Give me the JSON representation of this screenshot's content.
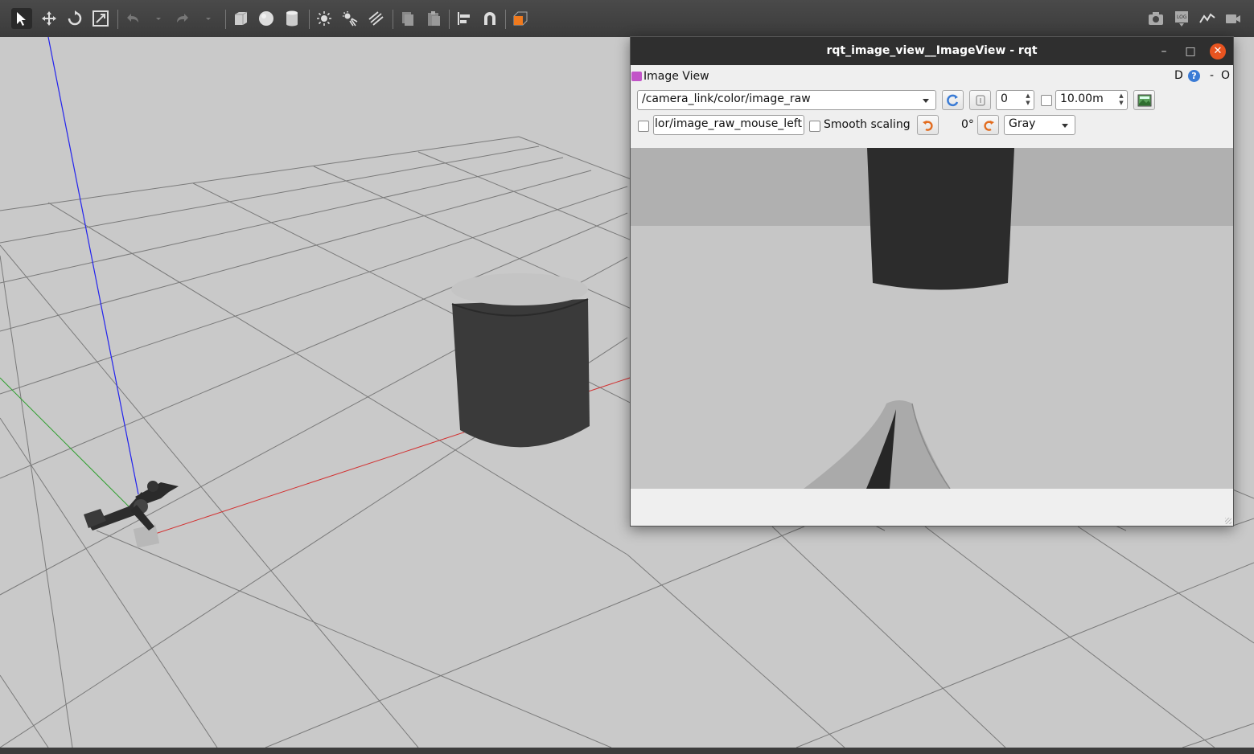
{
  "toolbar": {
    "left_tools": [
      "select-mode-icon",
      "translate-mode-icon",
      "rotate-mode-icon",
      "scale-mode-icon",
      "undo-icon",
      "undo-history-icon",
      "redo-icon",
      "redo-history-icon",
      "box-shape-icon",
      "sphere-shape-icon",
      "cylinder-shape-icon",
      "point-light-icon",
      "spot-light-icon",
      "directional-light-icon",
      "copy-icon",
      "paste-icon",
      "align-icon",
      "snap-icon",
      "view-angle-icon"
    ],
    "right_tools": [
      "screenshot-icon",
      "log-icon",
      "plot-icon",
      "record-video-icon"
    ],
    "log_badge": "LOG"
  },
  "rqt": {
    "window_title": "rqt_image_view__ImageView - rqt",
    "plugin_title": "Image View",
    "help_d": "D",
    "help_q": "?",
    "dash": "-",
    "close_o": "O",
    "topic_value": "/camera_link/color/image_raw",
    "spin_value": "0",
    "distance_value": "10.00m",
    "mouse_topic_value": "lor/image_raw_mouse_left",
    "smooth_label": "Smooth scaling",
    "rotation_value": "0°",
    "colormap_value": "Gray",
    "colors": {
      "titlebar": "#2f2f2f",
      "close_button": "#e95420"
    }
  }
}
